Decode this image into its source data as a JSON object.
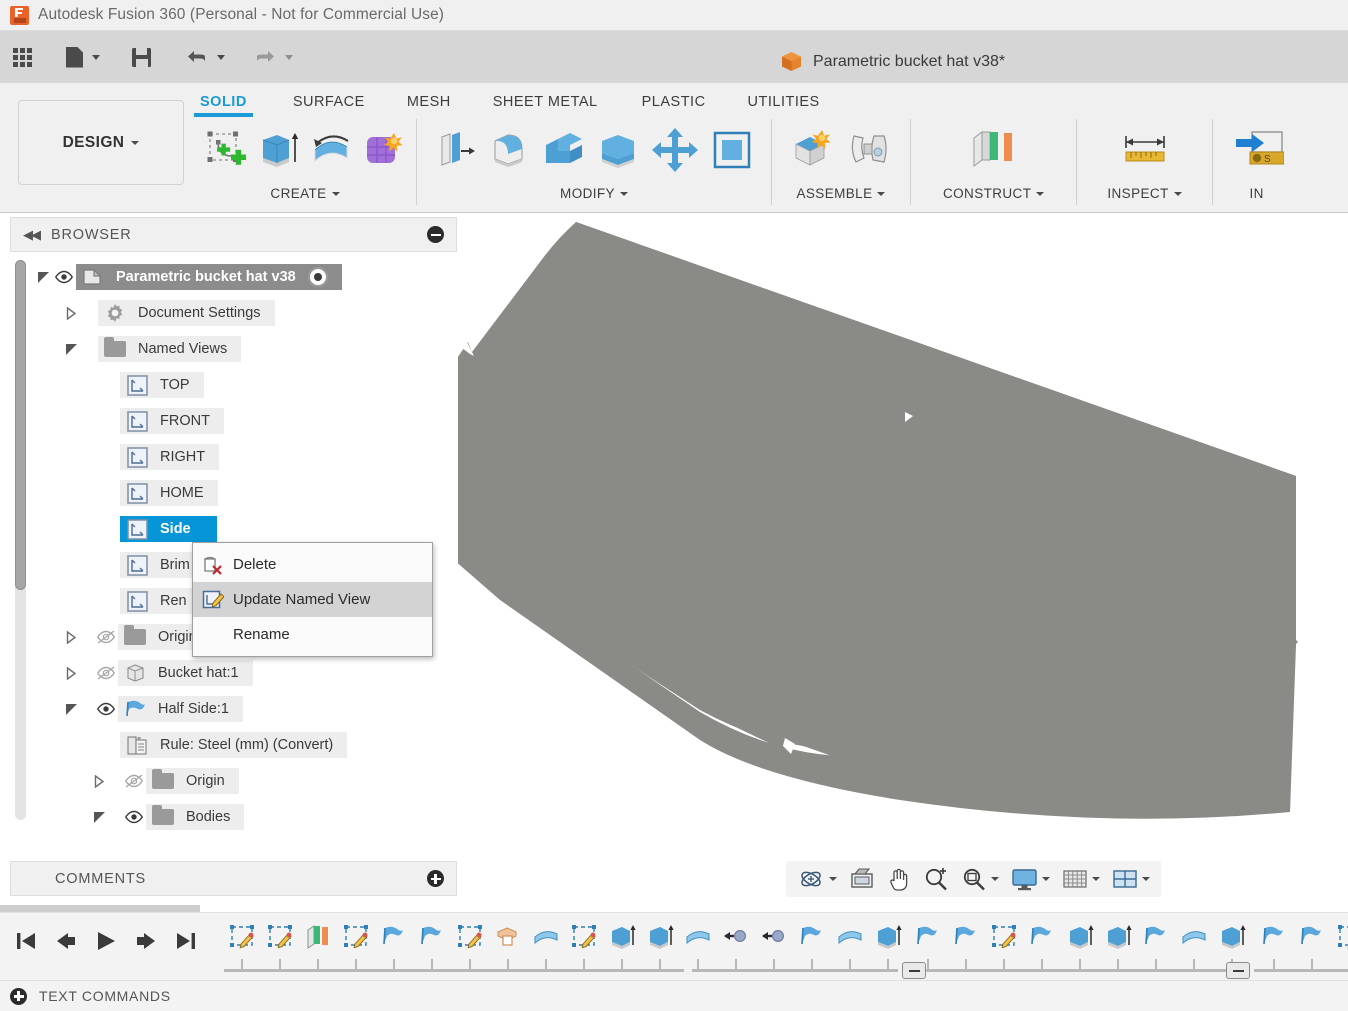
{
  "titlebar": {
    "app_title": "Autodesk Fusion 360 (Personal - Not for Commercial Use)",
    "logo": "fusion-logo"
  },
  "document": {
    "name": "Parametric bucket hat v38*"
  },
  "qat": {
    "items": [
      {
        "name": "show-data-panel-button",
        "icon": "grid-icon"
      },
      {
        "name": "file-button",
        "icon": "document-icon",
        "has_caret": true
      },
      {
        "name": "save-button",
        "icon": "save-icon"
      },
      {
        "name": "undo-button",
        "icon": "undo-arrow-icon",
        "has_caret": true
      },
      {
        "name": "redo-button",
        "icon": "redo-arrow-icon",
        "has_caret": true
      }
    ]
  },
  "ribbon": {
    "workspace_label": "DESIGN",
    "tabs": [
      {
        "label": "SOLID",
        "active": true
      },
      {
        "label": "SURFACE",
        "active": false
      },
      {
        "label": "MESH",
        "active": false
      },
      {
        "label": "SHEET METAL",
        "active": false
      },
      {
        "label": "PLASTIC",
        "active": false
      },
      {
        "label": "UTILITIES",
        "active": false
      }
    ],
    "groups": [
      {
        "title": "CREATE",
        "has_caret": true,
        "icons": [
          "create-sketch-icon",
          "extrude-icon",
          "revolve-icon",
          "form-icon"
        ]
      },
      {
        "title": "MODIFY",
        "has_caret": true,
        "icons": [
          "press-pull-icon",
          "fillet-icon",
          "shell-icon",
          "draft-icon",
          "move-copy-icon",
          "align-icon"
        ]
      },
      {
        "title": "ASSEMBLE",
        "has_caret": true,
        "icons": [
          "new-component-icon",
          "joint-icon"
        ]
      },
      {
        "title": "CONSTRUCT",
        "has_caret": true,
        "icons": [
          "offset-plane-icon"
        ]
      },
      {
        "title": "INSPECT",
        "has_caret": true,
        "icons": [
          "measure-icon"
        ]
      },
      {
        "title": "IN",
        "has_caret": false,
        "icons": [
          "insert-derive-icon"
        ]
      }
    ]
  },
  "browser": {
    "header_title": "BROWSER",
    "collapse_icon": "collapse-left-icon",
    "minimize_icon": "minus-circle-icon",
    "tree": [
      {
        "label": "Parametric bucket hat v38",
        "icon": "component-icon",
        "state": "root",
        "expander": "down",
        "eye": "visible",
        "has_target": true,
        "indent": 0
      },
      {
        "label": "Document Settings",
        "icon": "gear-icon",
        "state": "normal",
        "expander": "right",
        "eye": "none",
        "indent": 1
      },
      {
        "label": "Named Views",
        "icon": "folder-icon",
        "state": "normal",
        "expander": "down",
        "eye": "none",
        "indent": 1
      },
      {
        "label": "TOP",
        "icon": "named-view-icon",
        "state": "normal",
        "expander": "none",
        "eye": "none",
        "indent": 2
      },
      {
        "label": "FRONT",
        "icon": "named-view-icon",
        "state": "normal",
        "expander": "none",
        "eye": "none",
        "indent": 2
      },
      {
        "label": "RIGHT",
        "icon": "named-view-icon",
        "state": "normal",
        "expander": "none",
        "eye": "none",
        "indent": 2
      },
      {
        "label": "HOME",
        "icon": "named-view-icon",
        "state": "normal",
        "expander": "none",
        "eye": "none",
        "indent": 2
      },
      {
        "label": "Side",
        "icon": "named-view-icon",
        "state": "selected",
        "expander": "none",
        "eye": "none",
        "indent": 2
      },
      {
        "label": "Brim",
        "icon": "named-view-icon",
        "state": "normal",
        "expander": "none",
        "eye": "none",
        "indent": 2,
        "occluded": true
      },
      {
        "label": "Ren",
        "icon": "named-view-icon",
        "state": "normal",
        "expander": "none",
        "eye": "none",
        "indent": 2,
        "occluded": true
      },
      {
        "label": "Origin",
        "icon": "folder-icon",
        "state": "normal",
        "expander": "right",
        "eye": "hidden",
        "indent": 1,
        "occluded": true
      },
      {
        "label": "Bucket hat:1",
        "icon": "body-icon",
        "state": "normal",
        "expander": "right",
        "eye": "hidden",
        "indent": 1
      },
      {
        "label": "Half Side:1",
        "icon": "sheetmetal-flag-icon",
        "state": "normal",
        "expander": "down",
        "eye": "visible",
        "indent": 1
      },
      {
        "label": "Rule: Steel (mm) (Convert)",
        "icon": "rule-icon",
        "state": "normal",
        "expander": "none",
        "eye": "none",
        "indent": 2
      },
      {
        "label": "Origin",
        "icon": "folder-icon",
        "state": "normal",
        "expander": "right",
        "eye": "hidden",
        "indent": 2
      },
      {
        "label": "Bodies",
        "icon": "folder-icon",
        "state": "normal",
        "expander": "down",
        "eye": "visible",
        "indent": 2
      }
    ]
  },
  "context_menu": {
    "items": [
      {
        "label": "Delete",
        "icon": "delete-icon",
        "highlighted": false
      },
      {
        "label": "Update Named View",
        "icon": "update-named-view-icon",
        "highlighted": true
      },
      {
        "label": "Rename",
        "icon": "none",
        "highlighted": false
      }
    ]
  },
  "comments": {
    "title": "COMMENTS",
    "add_icon": "plus-circle-icon"
  },
  "navbar": {
    "items": [
      {
        "name": "orbit-button",
        "icon": "orbit-icon",
        "has_caret": true
      },
      {
        "name": "look-at-button",
        "icon": "look-at-icon",
        "has_caret": false
      },
      {
        "name": "pan-button",
        "icon": "hand-pan-icon",
        "has_caret": false
      },
      {
        "name": "zoom-button",
        "icon": "zoom-in-icon",
        "has_caret": false
      },
      {
        "name": "zoom-window-button",
        "icon": "zoom-window-icon",
        "has_caret": true
      },
      {
        "name": "display-settings-button",
        "icon": "monitor-display-icon",
        "has_caret": true
      },
      {
        "name": "grid-snaps-button",
        "icon": "grid-snaps-icon",
        "has_caret": true
      },
      {
        "name": "viewports-button",
        "icon": "viewports-icon",
        "has_caret": true
      }
    ]
  },
  "timeline": {
    "playback": [
      {
        "name": "go-to-beginning-button",
        "icon": "skip-start-icon"
      },
      {
        "name": "step-back-button",
        "icon": "step-back-icon"
      },
      {
        "name": "play-button",
        "icon": "play-icon"
      },
      {
        "name": "step-forward-button",
        "icon": "step-forward-icon"
      },
      {
        "name": "go-to-end-button",
        "icon": "skip-end-icon"
      }
    ],
    "features": [
      {
        "icon": "sketch-new-icon",
        "kind": "sketch"
      },
      {
        "icon": "sketch-edit-icon",
        "kind": "sketch"
      },
      {
        "icon": "plane-color-icon",
        "kind": "construct"
      },
      {
        "icon": "sketch-edit-icon",
        "kind": "sketch"
      },
      {
        "icon": "flange-icon",
        "kind": "sheetmetal"
      },
      {
        "icon": "flange-round-icon",
        "kind": "sheetmetal"
      },
      {
        "icon": "sketch-edit-icon",
        "kind": "sketch"
      },
      {
        "icon": "box-pattern-icon",
        "kind": "pattern"
      },
      {
        "icon": "loft-icon",
        "kind": "surface"
      },
      {
        "icon": "sketch-edit-icon",
        "kind": "sketch"
      },
      {
        "icon": "extrude-icon",
        "kind": "solid"
      },
      {
        "icon": "extrude-icon",
        "kind": "solid"
      },
      {
        "icon": "thicken-icon",
        "kind": "surface"
      },
      {
        "icon": "move-icon",
        "kind": "modify"
      },
      {
        "icon": "move-icon",
        "kind": "modify"
      },
      {
        "icon": "flag-icon",
        "kind": "sheetmetal"
      },
      {
        "icon": "loft-icon",
        "kind": "surface"
      },
      {
        "icon": "extrude-icon",
        "kind": "solid"
      },
      {
        "icon": "unfold-icon",
        "kind": "sheetmetal"
      },
      {
        "icon": "flat-pattern-icon",
        "kind": "sheetmetal"
      },
      {
        "icon": "sketch-edit-icon",
        "kind": "sketch"
      },
      {
        "icon": "fold-icon",
        "kind": "sheetmetal"
      },
      {
        "icon": "extrude-icon",
        "kind": "solid"
      },
      {
        "icon": "extrude-icon",
        "kind": "solid"
      },
      {
        "icon": "flag-icon",
        "kind": "sheetmetal"
      },
      {
        "icon": "loft-icon",
        "kind": "surface"
      },
      {
        "icon": "extrude-icon",
        "kind": "solid"
      },
      {
        "icon": "unfold-icon",
        "kind": "sheetmetal"
      },
      {
        "icon": "flat-pattern-icon",
        "kind": "sheetmetal"
      },
      {
        "icon": "sketch-edit-icon",
        "kind": "sketch"
      },
      {
        "icon": "fold-icon",
        "kind": "sheetmetal"
      },
      {
        "icon": "extrude-icon",
        "kind": "solid"
      }
    ]
  },
  "text_commands": {
    "label": "TEXT COMMANDS",
    "expand_icon": "plus-circle-icon"
  },
  "colors": {
    "accent": "#1c9ad6",
    "selection": "#0696d7",
    "model_gray": "#8a8b86",
    "titlebar_bg": "#f0f0f0",
    "qat_bg": "#d6d6d6",
    "ribbon_bg": "#f0f0f0",
    "row_bg": "#ededed",
    "root_row_bg": "#8c8c8c",
    "logo_orange": "#e8622a"
  }
}
